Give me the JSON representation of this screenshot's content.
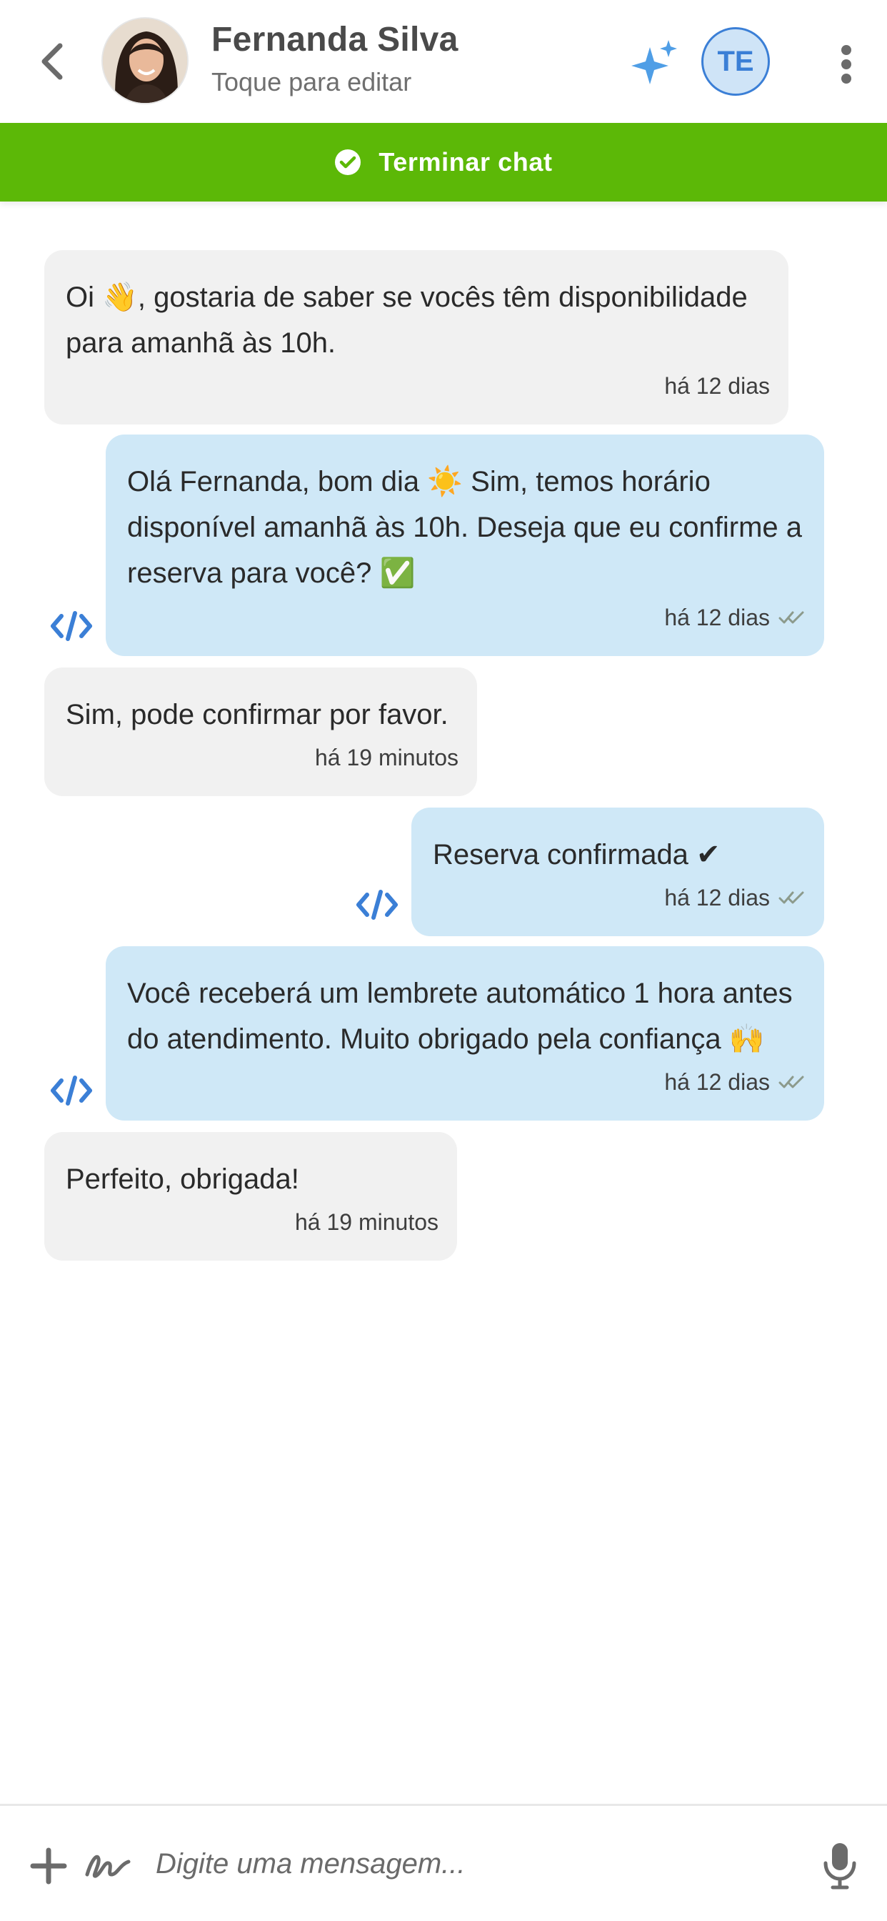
{
  "header": {
    "contact_name": "Fernanda Silva",
    "contact_subtitle": "Toque para editar",
    "user_initials": "TE",
    "back_icon": "chevron-left-icon",
    "sparkle_icon": "sparkle-icon",
    "more_icon": "vertical-dots-icon"
  },
  "end_chat": {
    "label": "Terminar chat",
    "color": "#5cb807"
  },
  "messages": [
    {
      "direction": "in",
      "text": "Oi 👋, gostaria de saber se vocês têm disponibilidade para amanhã às 10h.",
      "time": "há 12 dias"
    },
    {
      "direction": "out",
      "text": "Olá Fernanda, bom dia ☀️ Sim, temos horário disponível amanhã às 10h. Deseja que eu confirme a reserva para você? ✅",
      "time": "há 12 dias",
      "status": "read"
    },
    {
      "direction": "in",
      "text": "Sim, pode confirmar por favor.",
      "time": "há 19 minutos"
    },
    {
      "direction": "out",
      "text": "Reserva confirmada ✔",
      "time": "há 12 dias",
      "status": "read"
    },
    {
      "direction": "out",
      "text": "Você receberá um lembrete automático 1 hora antes do atendimento. Muito obrigado pela confiança 🙌",
      "time": "há 12 dias",
      "status": "read"
    },
    {
      "direction": "in",
      "text": "Perfeito, obrigada!",
      "time": "há 19 minutos"
    }
  ],
  "composer": {
    "placeholder": "Digite uma mensagem...",
    "plus_icon": "plus-icon",
    "scribble_icon": "signature-icon",
    "mic_icon": "microphone-icon"
  },
  "colors": {
    "incoming_bubble": "#f1f1f1",
    "outgoing_bubble": "#cfe8f7",
    "accent_blue": "#3b7fd6"
  }
}
